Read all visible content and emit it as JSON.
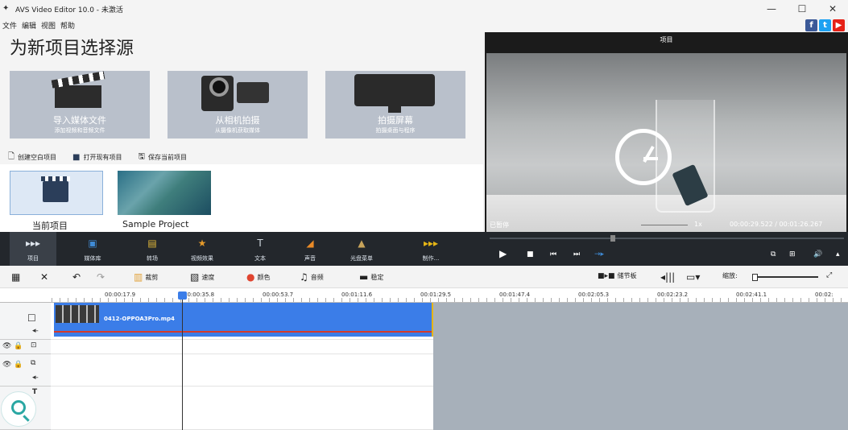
{
  "window": {
    "title": "AVS Video Editor 10.0 - 未激活",
    "controls": {
      "minimize": "—",
      "maximize": "☐",
      "close": "✕"
    }
  },
  "menu": [
    "文件",
    "编辑",
    "视图",
    "帮助"
  ],
  "social": {
    "facebook": "f",
    "twitter": "t",
    "youtube": "▶"
  },
  "source": {
    "title": "为新项目选择源",
    "cards": [
      {
        "label": "导入媒体文件",
        "sub": "添加视频和音频文件",
        "icon": "clapperboard-icon"
      },
      {
        "label": "从相机拍摄",
        "sub": "从摄像机获取媒体",
        "icon": "camcorder-icon"
      },
      {
        "label": "拍摄屏幕",
        "sub": "拍摄桌面与程序",
        "icon": "monitor-icon"
      }
    ],
    "actions": [
      {
        "label": "创建空白项目",
        "icon": "new-file-icon"
      },
      {
        "label": "打开现有项目",
        "icon": "folder-icon"
      },
      {
        "label": "保存当前项目",
        "icon": "save-icon"
      }
    ],
    "projects": [
      {
        "label": "当前项目"
      },
      {
        "label": "Sample Project"
      }
    ]
  },
  "preview": {
    "title": "项目",
    "status": "已暂停",
    "speed": "1x",
    "time": "00:00:29.522 / 00:01:26.267",
    "progress": 0.34
  },
  "toolbar": {
    "tools": [
      {
        "label": "项目",
        "icon": "project-icon",
        "color": "#dfe6ee"
      },
      {
        "label": "媒体库",
        "icon": "media-library-icon",
        "color": "#3f8bd6"
      },
      {
        "label": "转场",
        "icon": "transitions-icon",
        "color": "#e2b93a"
      },
      {
        "label": "视频效果",
        "icon": "video-effects-icon",
        "color": "#e59a2a"
      },
      {
        "label": "文本",
        "icon": "text-icon",
        "color": "#cfd6de"
      },
      {
        "label": "声音",
        "icon": "voice-icon",
        "color": "#e98a27"
      },
      {
        "label": "光盘菜单",
        "icon": "disc-menu-icon",
        "color": "#c7a35a"
      },
      {
        "label": "制作...",
        "icon": "produce-icon",
        "color": "#e5b516"
      }
    ],
    "playback": [
      "▶",
      "■",
      "⏮",
      "⏭",
      "→▸"
    ],
    "right": [
      "⧉",
      "⊞",
      "🔊",
      "▴"
    ]
  },
  "timeline_toolbar": {
    "items": [
      {
        "label": "",
        "icon": "storyboard-icon"
      },
      {
        "label": "",
        "icon": "delete-icon"
      },
      {
        "label": "",
        "icon": "undo-icon"
      },
      {
        "label": "",
        "icon": "redo-icon"
      },
      {
        "label": "裁剪",
        "icon": "trim-icon"
      },
      {
        "label": "速度",
        "icon": "speed-icon"
      },
      {
        "label": "颜色",
        "icon": "color-icon"
      },
      {
        "label": "音频",
        "icon": "audio-icon"
      },
      {
        "label": "稳定",
        "icon": "stabilize-icon"
      }
    ],
    "right": [
      {
        "label": "储节板",
        "icon": "storyboard-toggle-icon"
      },
      {
        "label": "",
        "icon": "audio-mixer-icon"
      },
      {
        "label": "",
        "icon": "display-icon"
      },
      {
        "label": "缩放:",
        "icon": ""
      }
    ]
  },
  "ruler": [
    "00:00:17.9",
    "00:00:35.8",
    "00:00:53.7",
    "00:01:11.6",
    "00:01:29.5",
    "00:01:47.4",
    "00:02:05.3",
    "00:02:23.2",
    "00:02:41.1",
    "00:02:"
  ],
  "clip": {
    "name": "0412-OPPOA3Pro.mp4"
  }
}
